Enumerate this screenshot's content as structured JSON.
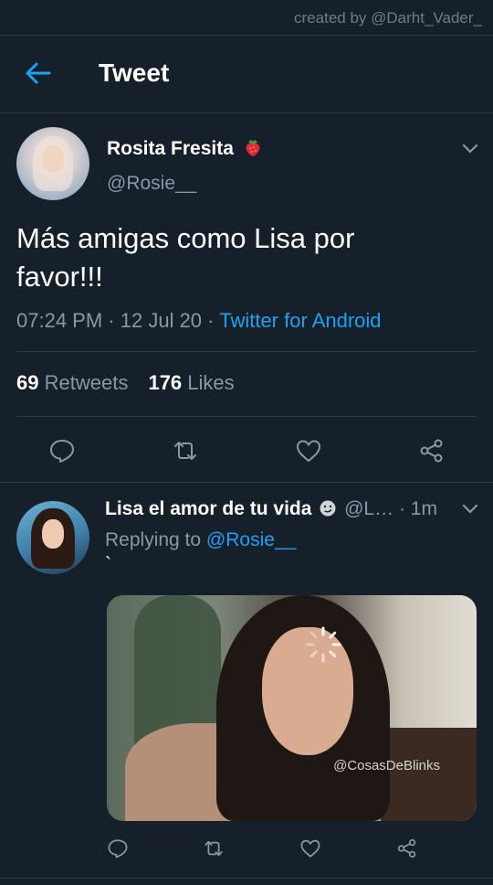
{
  "watermark": "created by @Darht_Vader_",
  "header": {
    "title": "Tweet",
    "back_icon": "arrow-left-icon"
  },
  "colors": {
    "background": "#15202b",
    "accent": "#1da1f2",
    "muted": "#8899a6",
    "divider": "#2c3947"
  },
  "tweet": {
    "display_name": "Rosita Fresita",
    "name_emoji": "strawberry-emoji",
    "handle": "@Rosie__",
    "text_line1": "Más amigas como Lisa por",
    "text_line2": "favor!!!",
    "time": "07:24 PM",
    "date": "12 Jul 20",
    "source": "Twitter for Android",
    "retweets_count": "69",
    "retweets_label": "Retweets",
    "likes_count": "176",
    "likes_label": "Likes"
  },
  "reply": {
    "display_name": "Lisa el amor de tu vida",
    "name_emoji": "smirk-emoji",
    "handle": "@L…",
    "dot": "·",
    "time": "1m",
    "replying_label": "Replying to",
    "replying_to": "@Rosie__",
    "text": "`",
    "media_watermark": "@CosasDeBlinks"
  }
}
